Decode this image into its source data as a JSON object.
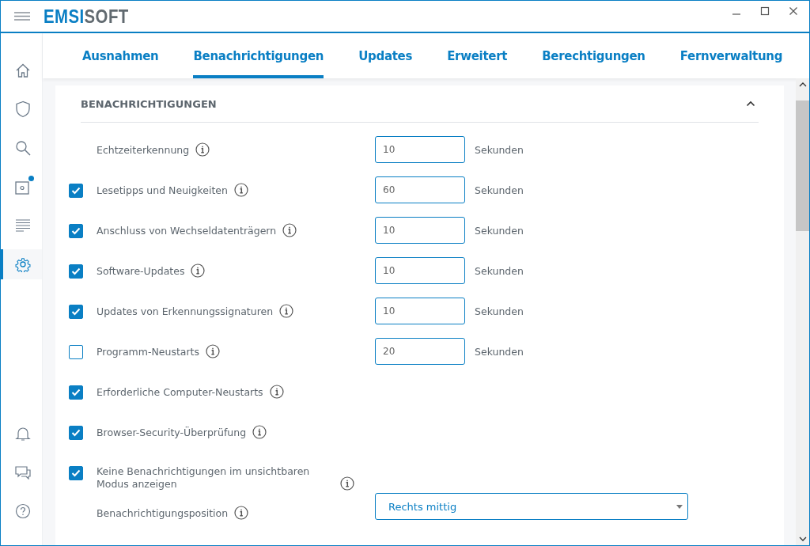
{
  "app": {
    "logo_primary": "EMSI",
    "logo_secondary": "SOFT"
  },
  "sidebar": {
    "items": [
      {
        "selected": false,
        "dot": false
      },
      {
        "selected": false,
        "dot": false
      },
      {
        "selected": false,
        "dot": false
      },
      {
        "selected": false,
        "dot": true
      },
      {
        "selected": false,
        "dot": false
      },
      {
        "selected": true,
        "dot": false
      }
    ]
  },
  "tabs": [
    {
      "label": "Ausnahmen",
      "selected": false
    },
    {
      "label": "Benachrichtigungen",
      "selected": true
    },
    {
      "label": "Updates",
      "selected": false
    },
    {
      "label": "Erweitert",
      "selected": false
    },
    {
      "label": "Berechtigungen",
      "selected": false
    },
    {
      "label": "Fernverwaltung",
      "selected": false
    }
  ],
  "section": {
    "title": "BENACHRICHTIGUNGEN",
    "expanded": true,
    "rows": [
      {
        "kind": "plain",
        "label": "Echtzeiterkennung",
        "value": "10",
        "unit": "Sekunden"
      },
      {
        "kind": "checkbox",
        "label": "Lesetipps und Neuigkeiten",
        "checked": true,
        "value": "60",
        "unit": "Sekunden"
      },
      {
        "kind": "checkbox",
        "label": "Anschluss von Wechseldatenträgern",
        "checked": true,
        "value": "10",
        "unit": "Sekunden"
      },
      {
        "kind": "checkbox",
        "label": "Software-Updates",
        "checked": true,
        "value": "10",
        "unit": "Sekunden"
      },
      {
        "kind": "checkbox",
        "label": "Updates von Erkennungssignaturen",
        "checked": true,
        "value": "10",
        "unit": "Sekunden"
      },
      {
        "kind": "checkbox",
        "label": "Programm-Neustarts",
        "checked": false,
        "value": "20",
        "unit": "Sekunden"
      },
      {
        "kind": "checkbox",
        "label": "Erforderliche Computer-Neustarts",
        "checked": true
      },
      {
        "kind": "checkbox",
        "label": "Browser-Security-Überprüfung",
        "checked": true
      },
      {
        "kind": "checkbox",
        "label": "Keine Benachrichtigungen im unsichtbaren Modus anzeigen",
        "checked": true
      },
      {
        "kind": "select",
        "label": "Benachrichtigungsposition",
        "value": "Rechts mittig"
      }
    ]
  }
}
